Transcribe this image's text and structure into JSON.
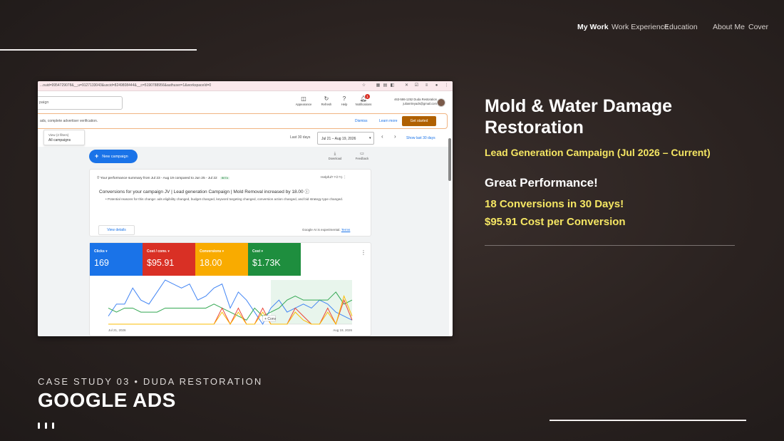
{
  "nav": {
    "items": [
      {
        "label": "My Work",
        "active": true
      },
      {
        "label": "Work Experience",
        "active": false
      },
      {
        "label": "Education",
        "active": false
      },
      {
        "label": "About Me",
        "active": false
      },
      {
        "label": "Cover",
        "active": false
      }
    ]
  },
  "screenshot": {
    "url": "...ouid=9954729078&__u=9127133043&uscid=8249808444&__c=5190788956&authuser=1&workspaceId=0",
    "search_placeholder": "paign",
    "toolbar": [
      {
        "icon": "appearance-icon",
        "label": "Appearance"
      },
      {
        "icon": "refresh-icon",
        "label": "Refresh"
      },
      {
        "icon": "help-icon",
        "label": "Help"
      },
      {
        "icon": "bell-icon",
        "label": "Notifications",
        "badge": "1"
      }
    ],
    "account": {
      "phone_name": "463-586-1252 Duda Restoration",
      "email": "juliannleyads@gmail.com"
    },
    "banner": {
      "message": "ads, complete advertiser verification.",
      "dismiss": "Dismiss",
      "learn_more": "Learn more",
      "get_started": "Get started"
    },
    "filter": {
      "label": "View (2 filters)",
      "value": "All campaigns"
    },
    "date": {
      "range_label": "Last 30 days",
      "range_value": "Jul 21 – Aug 19, 2026",
      "show_last": "Show last 30 days"
    },
    "new_campaign": "New campaign",
    "download": "Download",
    "feedback": "Feedback",
    "summary": {
      "header": "Your performance summary from Jul 23 - Aug 19 compared to Jun 25 - Jul 22",
      "beta": "BETA",
      "helpful": "Helpful?",
      "headline": "Conversions for your campaign JV | Lead generation Campaign | Mold Removal increased by 18.00 ⓘ",
      "bullet": "Potential reasons for this change: ads eligibility changed, budget changed, keyword targeting changed, conversion action changed, and bid strategy type changed.",
      "view_details": "View details",
      "ai_note": "Google AI is experimental.",
      "terms": "Terms"
    },
    "metrics": [
      {
        "label": "Clicks ▾",
        "value": "169",
        "color": "#1a73e8"
      },
      {
        "label": "Cost / conv. ▾",
        "value": "$95.91",
        "color": "#d93025"
      },
      {
        "label": "Conversions ▾",
        "value": "18.00",
        "color": "#f9ab00"
      },
      {
        "label": "Cost ▾",
        "value": "$1.73K",
        "color": "#1e8e3e"
      }
    ],
    "chart_data": {
      "type": "line",
      "x_start_label": "Jul 21, 2026",
      "x_end_label": "Aug 19, 2026",
      "annotation": "Conv",
      "series": [
        {
          "color": "#4285f4",
          "values": [
            2,
            5,
            5,
            9,
            6,
            5,
            8,
            11,
            10,
            9,
            10,
            6,
            7,
            9,
            10,
            4,
            8,
            6,
            3,
            0,
            4,
            6,
            3,
            4,
            5,
            4,
            6,
            5,
            3,
            2,
            1
          ]
        },
        {
          "color": "#34a853",
          "values": [
            4,
            3,
            4,
            4,
            3,
            3,
            3,
            4,
            4,
            4,
            4,
            4,
            4,
            5,
            4,
            3,
            2,
            1,
            4,
            2,
            3,
            4,
            6,
            7,
            6,
            6,
            6,
            6,
            8,
            5,
            6
          ]
        },
        {
          "color": "#ea4335",
          "values": [
            0,
            0,
            0,
            0,
            0,
            0,
            0,
            0,
            0,
            0,
            0,
            0,
            0,
            0,
            4,
            0,
            4,
            0,
            0,
            4,
            0,
            0,
            0,
            4,
            2,
            0,
            0,
            4,
            0,
            6,
            1
          ]
        },
        {
          "color": "#fbbc04",
          "values": [
            0,
            0,
            0,
            0,
            0,
            0,
            0,
            0,
            0,
            0,
            0,
            0,
            0,
            0,
            3,
            0,
            3,
            0,
            0,
            3,
            0,
            0,
            0,
            3,
            1,
            0,
            0,
            3,
            0,
            7,
            2
          ]
        }
      ]
    }
  },
  "panel": {
    "title": "Mold & Water Damage Restoration",
    "subtitle": "Lead Generation Campaign (Jul 2026 – Current)",
    "performance": "Great Performance!",
    "stat1": "18 Conversions in 30 Days!",
    "stat2": "$95.91 Cost per Conversion"
  },
  "footer": {
    "eyebrow": "CASE STUDY 03 • DUDA RESTORATION",
    "title": "GOOGLE ADS"
  }
}
